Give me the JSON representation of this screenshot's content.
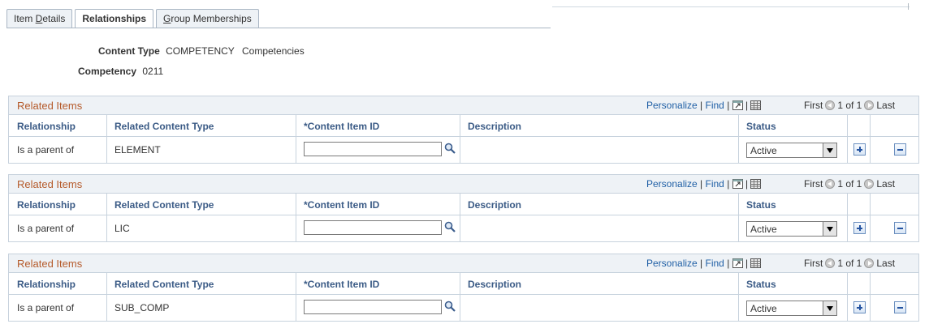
{
  "tabs": [
    {
      "label": "Item Details",
      "pre": "Item ",
      "under": "D",
      "post": "etails",
      "active": false
    },
    {
      "label": "Relationships",
      "pre": "Relationships",
      "under": "",
      "post": "",
      "active": true
    },
    {
      "label": "Group Memberships",
      "pre": "",
      "under": "G",
      "post": "roup Memberships",
      "active": false
    }
  ],
  "header": {
    "content_type_label": "Content Type",
    "content_type_value": "COMPETENCY",
    "content_type_desc": "Competencies",
    "competency_label": "Competency",
    "competency_value": "0211"
  },
  "grid_common": {
    "title": "Related Items",
    "personalize": "Personalize",
    "find": "Find",
    "sep": "|",
    "first": "First",
    "count": "1 of 1",
    "last": "Last",
    "columns": {
      "relationship": "Relationship",
      "related_content_type": "Related Content Type",
      "content_item_id": "*Content Item ID",
      "description": "Description",
      "status": "Status"
    }
  },
  "grids": [
    {
      "relationship": "Is a parent of",
      "related_content_type": "ELEMENT",
      "content_item_id": "",
      "description": "",
      "status": "Active"
    },
    {
      "relationship": "Is a parent of",
      "related_content_type": "LIC",
      "content_item_id": "",
      "description": "",
      "status": "Active"
    },
    {
      "relationship": "Is a parent of",
      "related_content_type": "SUB_COMP",
      "content_item_id": "",
      "description": "",
      "status": "Active"
    }
  ]
}
